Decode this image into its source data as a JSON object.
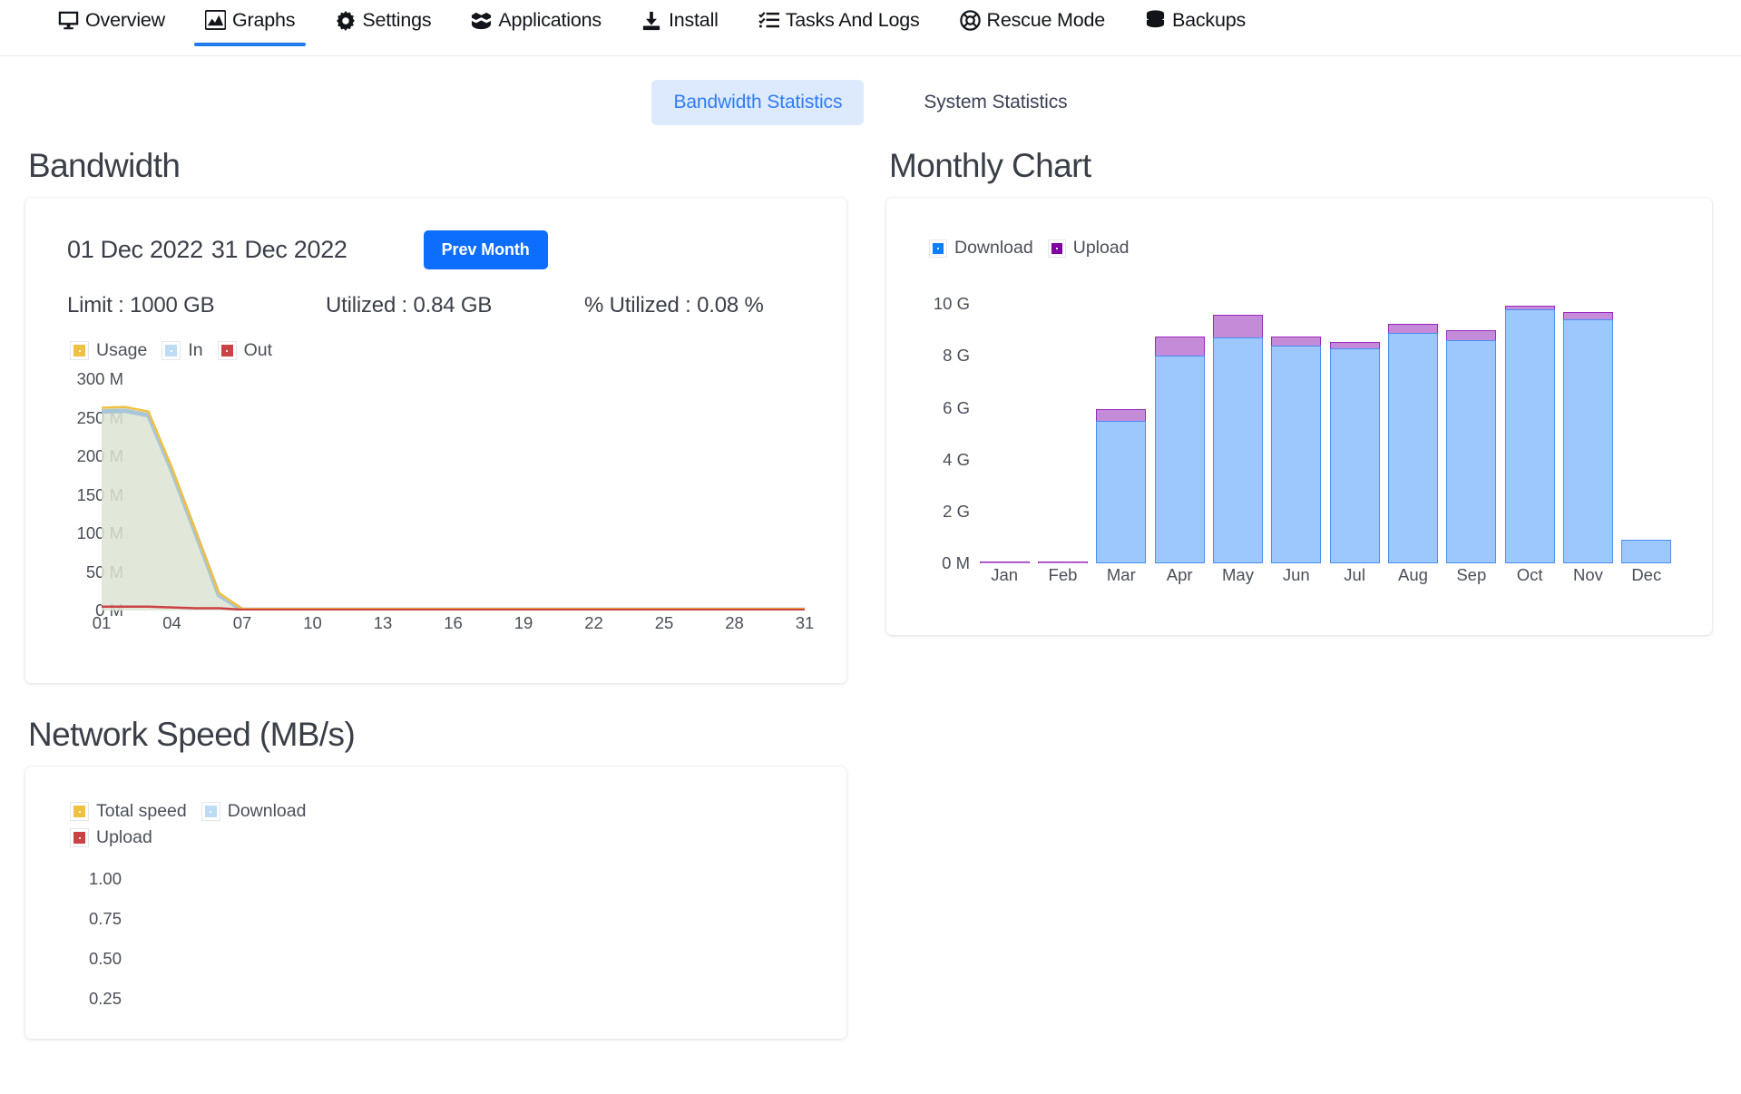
{
  "nav": {
    "items": [
      {
        "label": "Overview",
        "icon": "monitor-icon",
        "active": false
      },
      {
        "label": "Graphs",
        "icon": "chart-icon",
        "active": true
      },
      {
        "label": "Settings",
        "icon": "gear-icon",
        "active": false
      },
      {
        "label": "Applications",
        "icon": "apps-icon",
        "active": false
      },
      {
        "label": "Install",
        "icon": "download-icon",
        "active": false
      },
      {
        "label": "Tasks And Logs",
        "icon": "tasks-icon",
        "active": false
      },
      {
        "label": "Rescue Mode",
        "icon": "lifering-icon",
        "active": false
      },
      {
        "label": "Backups",
        "icon": "database-icon",
        "active": false
      }
    ]
  },
  "subtabs": [
    {
      "label": "Bandwidth Statistics",
      "active": true
    },
    {
      "label": "System Statistics",
      "active": false
    }
  ],
  "bandwidth": {
    "section_title": "Bandwidth",
    "date_from": "01 Dec 2022",
    "date_to": "31 Dec 2022",
    "prev_month_label": "Prev Month",
    "limit": "Limit : 1000 GB",
    "utilized": "Utilized : 0.84 GB",
    "percent_utilized": "% Utilized : 0.08 %"
  },
  "monthly": {
    "section_title": "Monthly Chart"
  },
  "network_speed": {
    "section_title": "Network Speed (MB/s)"
  },
  "colors": {
    "accent_blue": "#0d6efd",
    "tab_active_bg": "#ddeafe",
    "tab_active_text": "#2f7cf6",
    "usage_yellow": "#f0c040",
    "in_lightblue": "#bcdcf4",
    "out_red": "#cc4244",
    "download_blue": "#0c7ffb",
    "upload_purple": "#8000a0",
    "bar_download_fill": "#9cc8fd",
    "bar_download_stroke": "#4b8ef7",
    "bar_upload_fill": "#c48bd8",
    "bar_upload_stroke": "#9b28c0",
    "area_fill": "#dde4d2"
  },
  "chart_data": [
    {
      "id": "bandwidth-daily",
      "type": "area",
      "title": "Bandwidth",
      "xlabel": "",
      "ylabel": "",
      "ylim": [
        0,
        300000000
      ],
      "ytick_labels": [
        "0 M",
        "50 M",
        "100 M",
        "150 M",
        "200 M",
        "250 M",
        "300 M"
      ],
      "ytick_values": [
        0,
        50,
        100,
        150,
        200,
        250,
        300
      ],
      "xtick_labels": [
        "01",
        "04",
        "07",
        "10",
        "13",
        "16",
        "19",
        "22",
        "25",
        "28",
        "31"
      ],
      "x": [
        1,
        2,
        3,
        4,
        5,
        6,
        7,
        8,
        9,
        10,
        11,
        12,
        13,
        14,
        15,
        16,
        17,
        18,
        19,
        20,
        21,
        22,
        23,
        24,
        25,
        26,
        27,
        28,
        29,
        30,
        31
      ],
      "legend": [
        "Usage",
        "In",
        "Out"
      ],
      "legend_position": "top-left",
      "grid": false,
      "series": [
        {
          "name": "Usage",
          "color": "#f0c040",
          "values": [
            263,
            264,
            258,
            185,
            104,
            23,
            2,
            2,
            2,
            2,
            2,
            2,
            2,
            2,
            2,
            2,
            2,
            2,
            2,
            2,
            2,
            2,
            2,
            2,
            2,
            2,
            2,
            2,
            2,
            2,
            2
          ]
        },
        {
          "name": "In",
          "color": "#bcdcf4",
          "values": [
            258,
            259,
            253,
            181,
            101,
            20,
            1,
            1,
            1,
            1,
            1,
            1,
            1,
            1,
            1,
            1,
            1,
            1,
            1,
            1,
            1,
            1,
            1,
            1,
            1,
            1,
            1,
            1,
            1,
            1,
            1
          ]
        },
        {
          "name": "Out",
          "color": "#cc4244",
          "values": [
            5,
            5,
            5,
            4,
            3,
            3,
            1,
            1,
            1,
            1,
            1,
            1,
            1,
            1,
            1,
            1,
            1,
            1,
            1,
            1,
            1,
            1,
            1,
            1,
            1,
            1,
            1,
            1,
            1,
            1,
            1
          ]
        }
      ]
    },
    {
      "id": "monthly-chart",
      "type": "bar",
      "title": "Monthly Chart",
      "stacked": true,
      "xlabel": "",
      "ylabel": "",
      "ylim": [
        0,
        11.2
      ],
      "yunit": "G",
      "ytick_labels": [
        "0 M",
        "2 G",
        "4 G",
        "6 G",
        "8 G",
        "10 G"
      ],
      "ytick_values": [
        0,
        2,
        4,
        6,
        8,
        10
      ],
      "categories": [
        "Jan",
        "Feb",
        "Mar",
        "Apr",
        "May",
        "Jun",
        "Jul",
        "Aug",
        "Sep",
        "Oct",
        "Nov",
        "Dec"
      ],
      "legend": [
        "Download",
        "Upload"
      ],
      "legend_position": "top-left",
      "grid": false,
      "series": [
        {
          "name": "Download",
          "color": "#9cc8fd",
          "values": [
            0,
            0,
            5.5,
            8.0,
            8.7,
            8.4,
            8.3,
            8.9,
            8.6,
            9.8,
            9.4,
            0.9
          ]
        },
        {
          "name": "Upload",
          "color": "#c48bd8",
          "values": [
            0.03,
            0.03,
            0.45,
            0.75,
            0.9,
            0.35,
            0.25,
            0.35,
            0.4,
            0.15,
            0.3,
            0.0
          ]
        }
      ]
    },
    {
      "id": "network-speed",
      "type": "line",
      "title": "Network Speed (MB/s)",
      "xlabel": "",
      "ylabel": "",
      "ylim": [
        0,
        1.0
      ],
      "ytick_labels": [
        "0.25",
        "0.50",
        "0.75",
        "1.00"
      ],
      "ytick_values": [
        0.25,
        0.5,
        0.75,
        1.0
      ],
      "legend": [
        "Total speed",
        "Download",
        "Upload"
      ],
      "legend_position": "top-left",
      "grid": false,
      "series": [
        {
          "name": "Total speed",
          "color": "#f0c040",
          "values": []
        },
        {
          "name": "Download",
          "color": "#bcdcf4",
          "values": []
        },
        {
          "name": "Upload",
          "color": "#cc4244",
          "values": []
        }
      ]
    }
  ]
}
